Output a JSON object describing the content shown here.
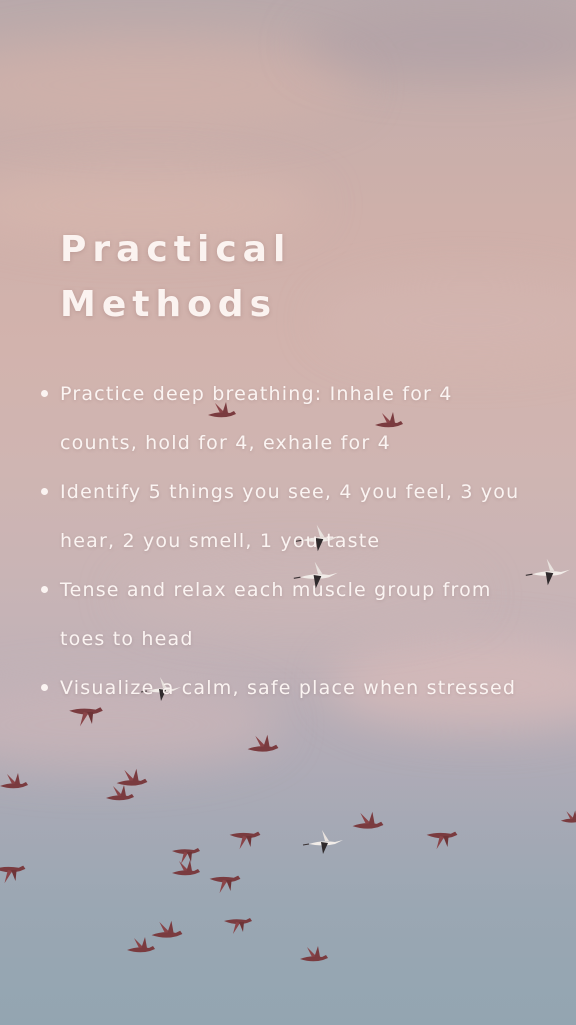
{
  "title": {
    "line1": "Practical",
    "line2": "Methods"
  },
  "methods": [
    {
      "text": "Practice deep breathing: Inhale for 4 counts, hold for 4, exhale for 4"
    },
    {
      "text": "Identify 5 things you see, 4 you feel, 3 you hear, 2 you smell, 1 you taste"
    },
    {
      "text": "Tense and relax each muscle group from toes to head"
    },
    {
      "text": "Visualize a calm, safe place when stressed"
    }
  ],
  "background": {
    "sky_top_color": "#b9a9ab",
    "sky_mid_color": "#d2b3ad",
    "sky_bottom_color": "#93a5b1",
    "bird_color": "#7a3b3f",
    "bird_accent_color": "#f1ece8"
  }
}
